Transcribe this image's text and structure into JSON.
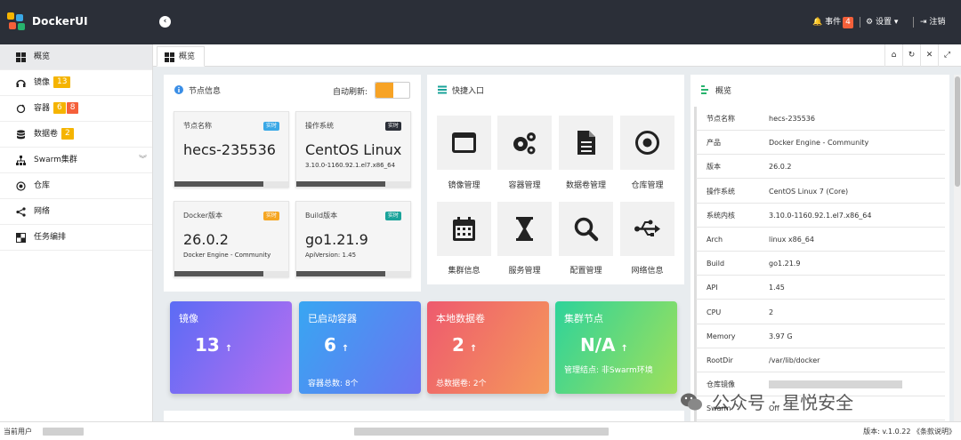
{
  "app": {
    "title": "DockerUI"
  },
  "header": {
    "events_label": "事件",
    "events_count": "4",
    "settings_label": "设置",
    "logout_label": "注销"
  },
  "sidebar": {
    "items": [
      {
        "label": "概览",
        "icon": "windows-icon"
      },
      {
        "label": "镜像",
        "icon": "headphones-icon",
        "badges": [
          "13"
        ]
      },
      {
        "label": "容器",
        "icon": "refresh-icon",
        "badges": [
          "6",
          "8"
        ]
      },
      {
        "label": "数据卷",
        "icon": "database-icon",
        "badges": [
          "2"
        ]
      },
      {
        "label": "Swarm集群",
        "icon": "sitemap-icon"
      },
      {
        "label": "仓库",
        "icon": "target-icon"
      },
      {
        "label": "网络",
        "icon": "share-icon"
      },
      {
        "label": "任务编排",
        "icon": "checkerboard-icon"
      }
    ]
  },
  "tabs": [
    {
      "label": "概览"
    }
  ],
  "node_info": {
    "title": "节点信息",
    "auto_refresh_label": "自动刷新:",
    "cards": [
      {
        "label": "节点名称",
        "tag": "实时",
        "value": "hecs-235536",
        "sub": "",
        "progress": 0.78
      },
      {
        "label": "操作系统",
        "tag": "实时",
        "value": "CentOS Linux",
        "sub": "3.10.0-1160.92.1.el7.x86_64",
        "progress": 0.78
      },
      {
        "label": "Docker版本",
        "tag": "实时",
        "value": "26.0.2",
        "sub": "Docker Engine - Community",
        "progress": 0.78
      },
      {
        "label": "Build版本",
        "tag": "实时",
        "value": "go1.21.9",
        "sub": "ApiVersion: 1.45",
        "progress": 0.78
      }
    ],
    "tag_colors": [
      "#3aa8e6",
      "#2b2f38",
      "#f5a623",
      "#1aa39a"
    ]
  },
  "quick_entry": {
    "title": "快捷入口",
    "items": [
      {
        "label": "镜像管理",
        "icon": "window-icon"
      },
      {
        "label": "容器管理",
        "icon": "gears-icon"
      },
      {
        "label": "数据卷管理",
        "icon": "file-icon"
      },
      {
        "label": "仓库管理",
        "icon": "dot-circle-icon"
      },
      {
        "label": "集群信息",
        "icon": "calendar-icon"
      },
      {
        "label": "服务管理",
        "icon": "hourglass-icon"
      },
      {
        "label": "配置管理",
        "icon": "search-icon"
      },
      {
        "label": "网络信息",
        "icon": "usb-icon"
      }
    ]
  },
  "stats": [
    {
      "title": "镜像",
      "value": "13",
      "arrow": "↑",
      "footer": ""
    },
    {
      "title": "已启动容器",
      "value": "6",
      "arrow": "↑",
      "footer": "容器总数: 8个"
    },
    {
      "title": "本地数据卷",
      "value": "2",
      "arrow": "↑",
      "footer": "总数据卷: 2个"
    },
    {
      "title": "集群节点",
      "value": "N/A",
      "arrow": "↑",
      "footer": "管理结点: 非Swarm环境"
    }
  ],
  "overview": {
    "title": "概览",
    "rows": [
      {
        "key": "节点名称",
        "value": "hecs-235536"
      },
      {
        "key": "产品",
        "value": "Docker Engine - Community"
      },
      {
        "key": "版本",
        "value": "26.0.2"
      },
      {
        "key": "操作系统",
        "value": "CentOS Linux 7 (Core)"
      },
      {
        "key": "系统内核",
        "value": "3.10.0-1160.92.1.el7.x86_64"
      },
      {
        "key": "Arch",
        "value": "linux x86_64"
      },
      {
        "key": "Build",
        "value": "go1.21.9"
      },
      {
        "key": "API",
        "value": "1.45"
      },
      {
        "key": "CPU",
        "value": "2"
      },
      {
        "key": "Memory",
        "value": "3.97 G"
      },
      {
        "key": "RootDir",
        "value": "/var/lib/docker"
      },
      {
        "key": "仓库镜像",
        "value": ""
      },
      {
        "key": "Swarm",
        "value": "Off"
      }
    ]
  },
  "footer": {
    "current_user_label": "当前用户",
    "version_text": "版本: v.1.0.22 《条款说明》"
  },
  "watermark": {
    "text": "公众号 · 星悦安全"
  },
  "colors": {
    "header_bg": "#2b2f38",
    "badge_orange": "#f5603a",
    "badge_yellow": "#f5b400",
    "toggle_on": "#f7a325"
  }
}
